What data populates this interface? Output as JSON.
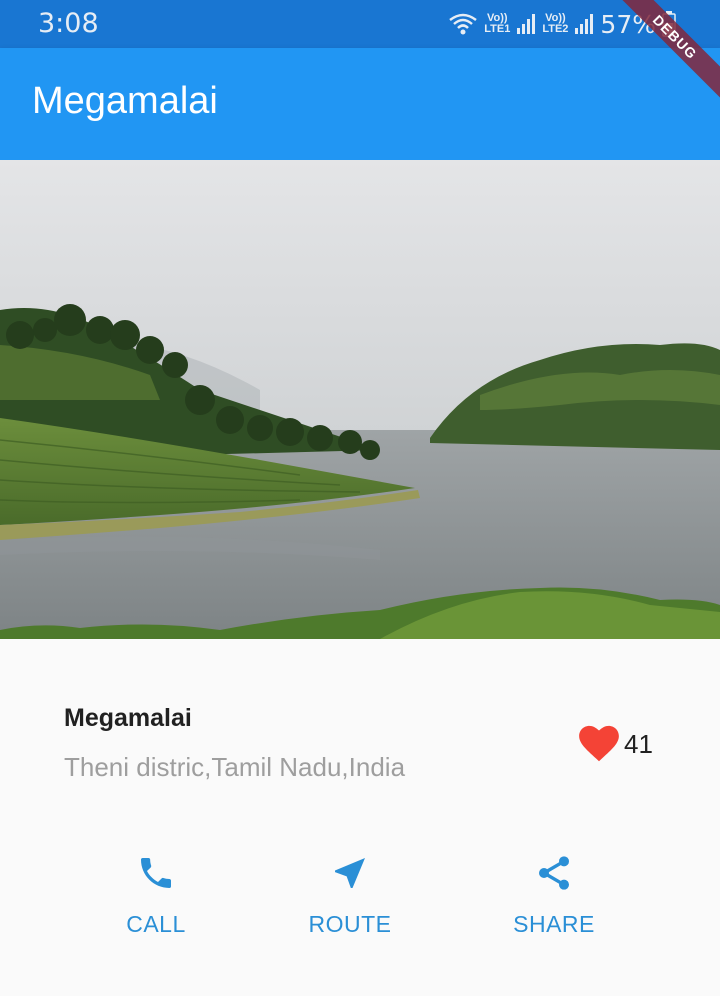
{
  "status_bar": {
    "time": "3:08",
    "sim1": "LTE1",
    "sim2": "LTE2",
    "volte1": "Vo))",
    "volte2": "Vo))",
    "battery": "57%"
  },
  "debug_banner": "DEBUG",
  "app_bar": {
    "title": "Megamalai"
  },
  "hero": {
    "description": "photo of lake with tea plantations and misty hills"
  },
  "place": {
    "name": "Megamalai",
    "location": "Theni distric,Tamil Nadu,India",
    "favorite_count": "41"
  },
  "actions": [
    {
      "label": "CALL",
      "icon": "phone-icon"
    },
    {
      "label": "ROUTE",
      "icon": "navigation-icon"
    },
    {
      "label": "SHARE",
      "icon": "share-icon"
    }
  ],
  "colors": {
    "primary": "#2196f3",
    "status_bar": "#1976d2",
    "action_blue": "#2a8fd6",
    "heart": "#f44336"
  }
}
